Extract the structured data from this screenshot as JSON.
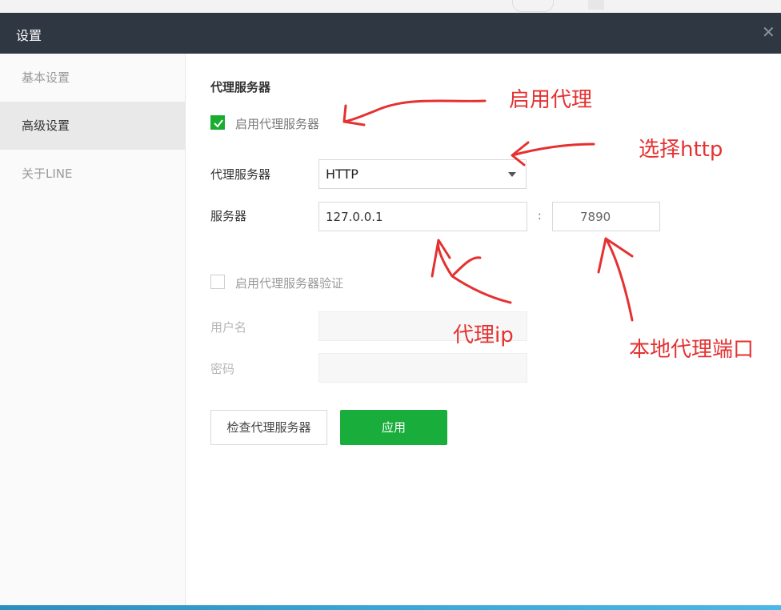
{
  "window": {
    "title": "设置"
  },
  "sidebar": {
    "items": [
      {
        "label": "基本设置",
        "active": false
      },
      {
        "label": "高级设置",
        "active": true
      },
      {
        "label": "关于LINE",
        "active": false
      }
    ]
  },
  "proxy": {
    "section_title": "代理服务器",
    "enable_label": "启用代理服务器",
    "enable_checked": true,
    "type_label": "代理服务器",
    "type_value": "HTTP",
    "server_label": "服务器",
    "server_value": "127.0.0.1",
    "colon": ":",
    "port_value": "7890",
    "auth_label": "启用代理服务器验证",
    "auth_checked": false,
    "username_label": "用户名",
    "password_label": "密码",
    "check_button": "检查代理服务器",
    "apply_button": "应用"
  },
  "annotations": {
    "enable_proxy": "启用代理",
    "choose_http": "选择http",
    "proxy_ip": "代理ip",
    "local_port": "本地代理端口",
    "color": "#e53131"
  },
  "colors": {
    "titlebar": "#2f3742",
    "accent_green": "#19ad3c"
  }
}
